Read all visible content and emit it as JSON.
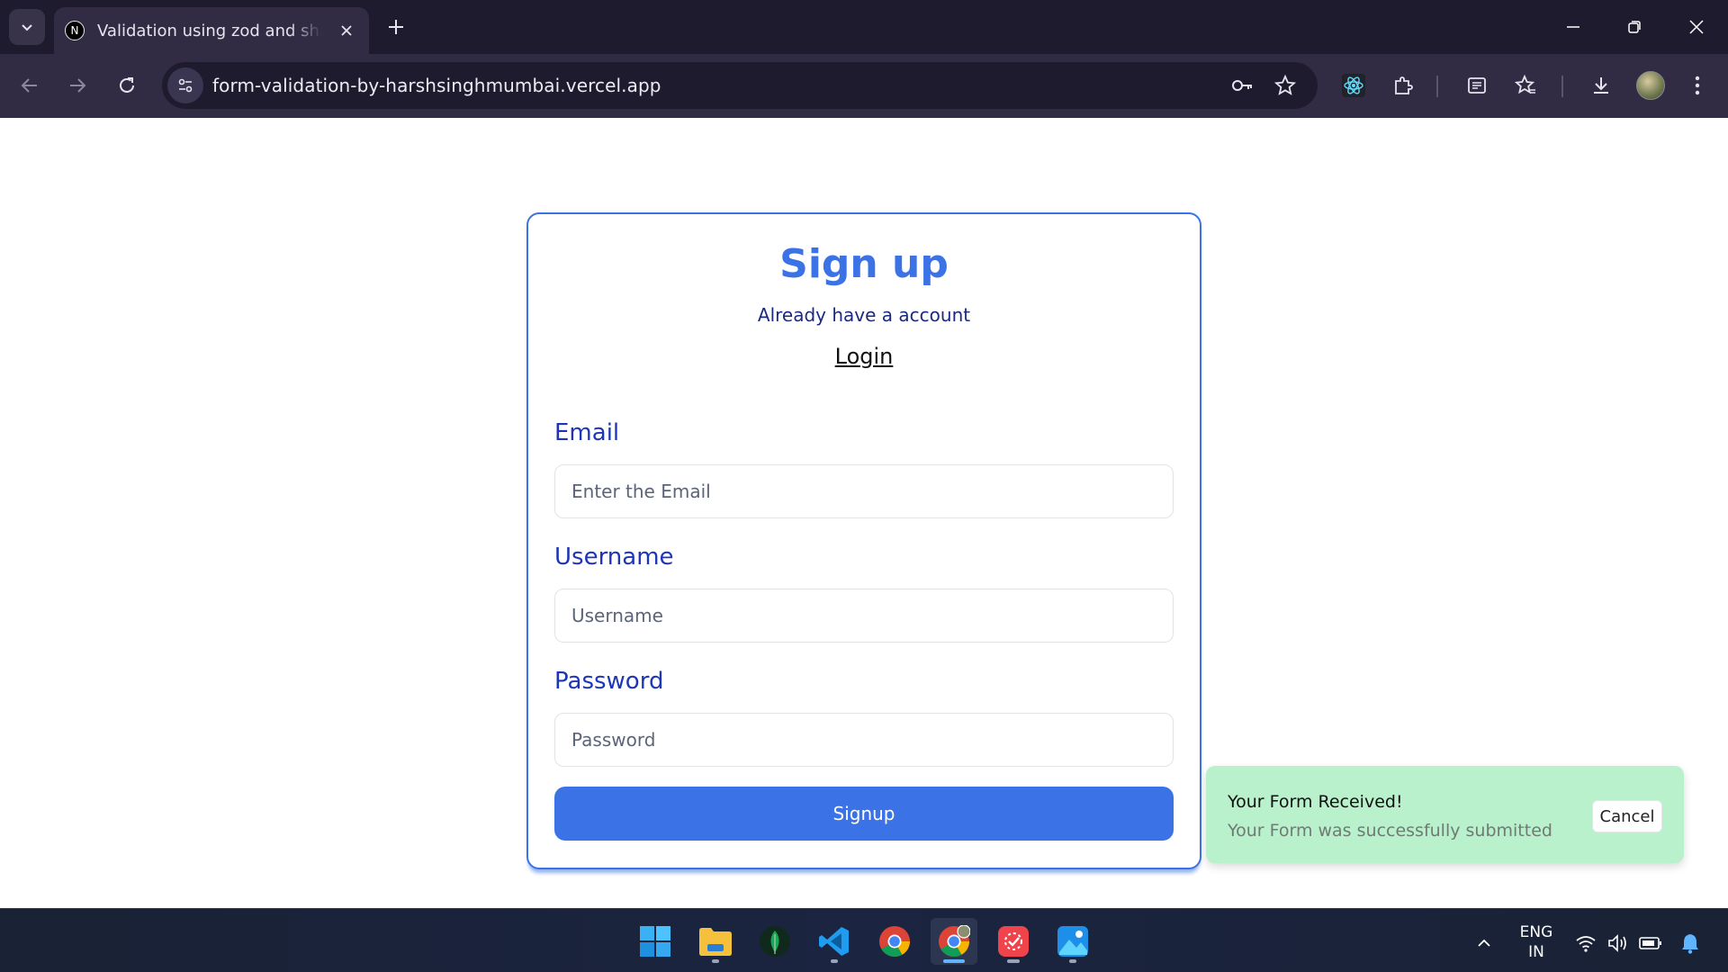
{
  "browser": {
    "tab": {
      "favicon_letter": "N",
      "title": "Validation using zod and shadcn"
    },
    "url": "form-validation-by-harshsinghmumbai.vercel.app"
  },
  "form": {
    "title": "Sign up",
    "subtitle": "Already have a account",
    "login_link": "Login",
    "email": {
      "label": "Email",
      "placeholder": "Enter the Email"
    },
    "username": {
      "label": "Username",
      "placeholder": "Username"
    },
    "password": {
      "label": "Password",
      "placeholder": "Password"
    },
    "submit_label": "Signup",
    "accent_color": "#3b73e6"
  },
  "toast": {
    "title": "Your Form Received!",
    "description": "Your Form was successfully submitted",
    "cancel_label": "Cancel",
    "background": "#b9f1cc"
  },
  "taskbar": {
    "apps": [
      "windows-start",
      "file-explorer",
      "mongodb-compass",
      "vscode",
      "chrome",
      "chrome-profile",
      "todo-app",
      "photos"
    ],
    "language_line1": "ENG",
    "language_line2": "IN"
  }
}
